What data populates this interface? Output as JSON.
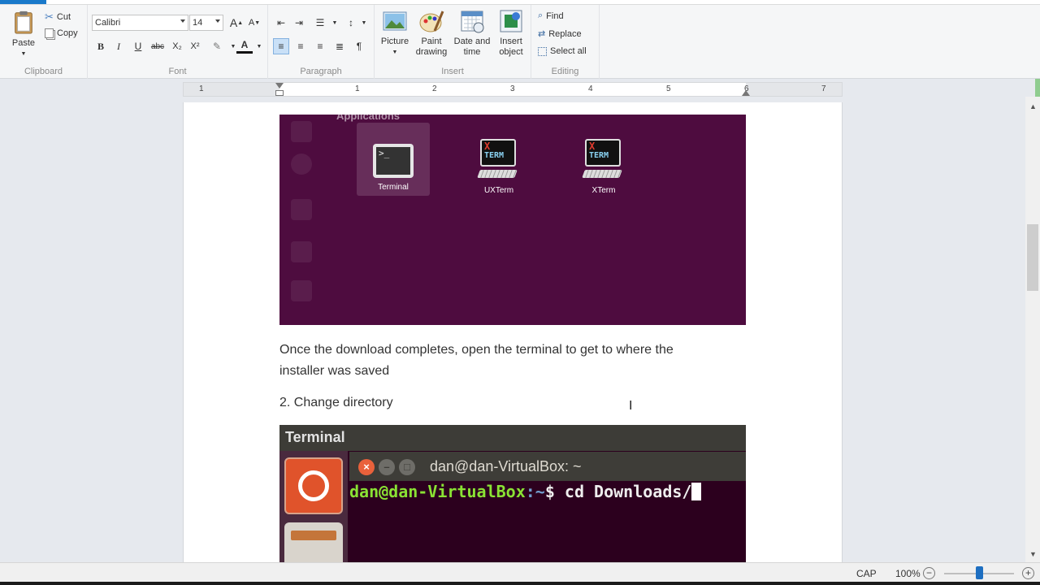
{
  "ribbon": {
    "clipboard": {
      "label": "Clipboard",
      "paste": "Paste",
      "cut": "Cut",
      "copy": "Copy"
    },
    "font": {
      "label": "Font",
      "family": "Calibri",
      "size": "14",
      "bold": "B",
      "italic": "I",
      "underline": "U",
      "strike": "abc",
      "subscript": "X₂",
      "superscript": "X²"
    },
    "paragraph": {
      "label": "Paragraph"
    },
    "insert": {
      "label": "Insert",
      "picture": "Picture",
      "paint": [
        "Paint",
        "drawing"
      ],
      "datetime": [
        "Date and",
        "time"
      ],
      "object": [
        "Insert",
        "object"
      ]
    },
    "editing": {
      "label": "Editing",
      "find": "Find",
      "replace": "Replace",
      "select_all": "Select all"
    }
  },
  "ruler": {
    "numbers": [
      "1",
      "1",
      "2",
      "3",
      "4",
      "5",
      "6",
      "7"
    ]
  },
  "document": {
    "screenshot1": {
      "header": "Applications",
      "apps": [
        {
          "label": "Terminal",
          "icon": "terminal-icon",
          "prompt": ">_"
        },
        {
          "label": "UXTerm",
          "icon": "xterm-icon",
          "x": "X",
          "term": "TERM"
        },
        {
          "label": "XTerm",
          "icon": "xterm-icon",
          "x": "X",
          "term": "TERM"
        }
      ]
    },
    "paragraph1": [
      "Once the download completes, open the terminal to get to where the",
      "installer was saved"
    ],
    "paragraph2": "2. Change directory",
    "screenshot2": {
      "title": "Terminal",
      "window_title": "dan@dan-VirtualBox: ~",
      "prompt_user": "dan@dan-VirtualBox",
      "prompt_path": ":~",
      "prompt_symbol": "$",
      "command": " cd Downloads/"
    }
  },
  "status": {
    "caps": "CAP",
    "zoom": "100%",
    "zoom_fraction": 0.5
  },
  "colors": {
    "accent": "#1979ca",
    "ubuntu_purple": "#4e0c3f",
    "terminal_bg": "#2c001e"
  }
}
